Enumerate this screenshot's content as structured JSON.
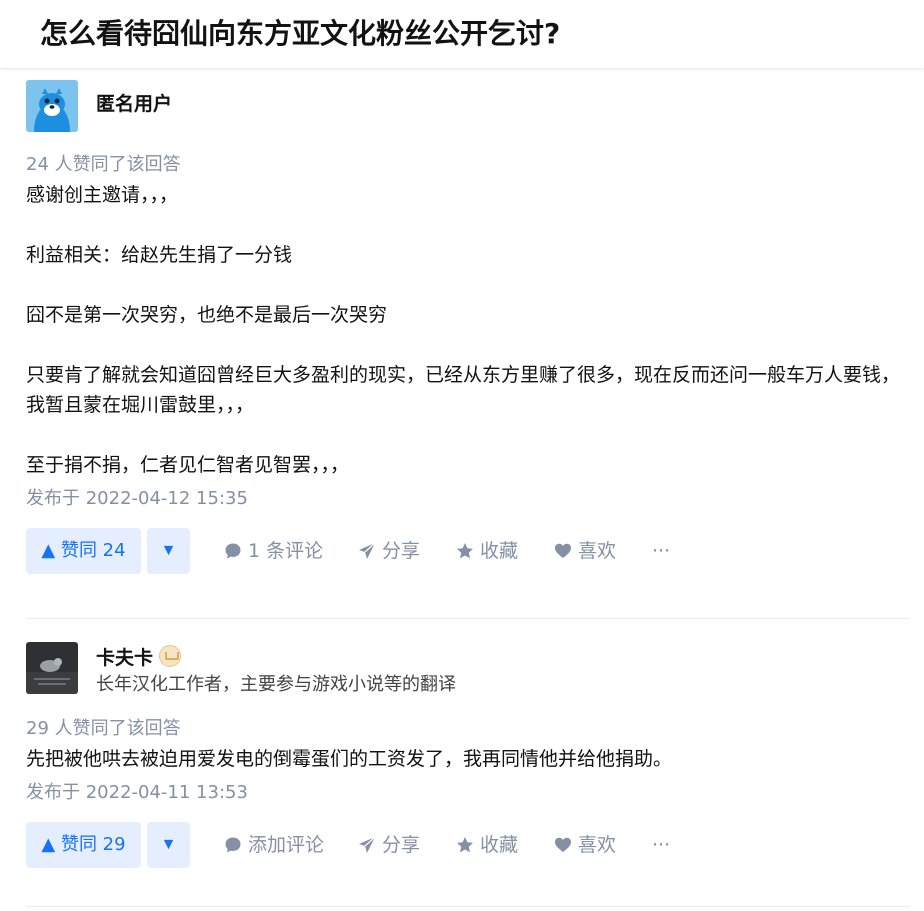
{
  "question": {
    "title": "怎么看待囧仙向东方亚文化粉丝公开乞讨?"
  },
  "answers": [
    {
      "author": {
        "name": "匿名用户",
        "bio": ""
      },
      "vote_meta": "24 人赞同了该回答",
      "paragraphs": [
        "感谢创主邀请，，，",
        "",
        "利益相关：给赵先生捐了一分钱",
        "",
        "囧不是第一次哭穷，也绝不是最后一次哭穷",
        "",
        "只要肯了解就会知道囧曾经巨大多盈利的现实，已经从东方里赚了很多，现在反而还问一般车万人要钱，我暂且蒙在堀川雷鼓里，，，",
        "",
        "至于捐不捐，仁者见仁智者见智罢，，，"
      ],
      "time": "发布于 2022-04-12 15:35",
      "actions": {
        "vote_up": "▲ 赞同 24",
        "vote_down": "▼",
        "comment": "1 条评论",
        "share": "分享",
        "collect": "收藏",
        "like": "喜欢",
        "more": "···"
      }
    },
    {
      "author": {
        "name": "卡夫卡",
        "bio": "长年汉化工作者，主要参与游戏小说等的翻译"
      },
      "vote_meta": "29 人赞同了该回答",
      "paragraphs": [
        "先把被他哄去被迫用爱发电的倒霉蛋们的工资发了，我再同情他并给他捐助。"
      ],
      "time": "发布于 2022-04-11 13:53",
      "actions": {
        "vote_up": "▲ 赞同 29",
        "vote_down": "▼",
        "comment": "添加评论",
        "share": "分享",
        "collect": "收藏",
        "like": "喜欢",
        "more": "···"
      }
    }
  ],
  "colors": {
    "accent": "#1772f6",
    "meta": "#8590a6",
    "vote_bg": "#e5eeff"
  }
}
